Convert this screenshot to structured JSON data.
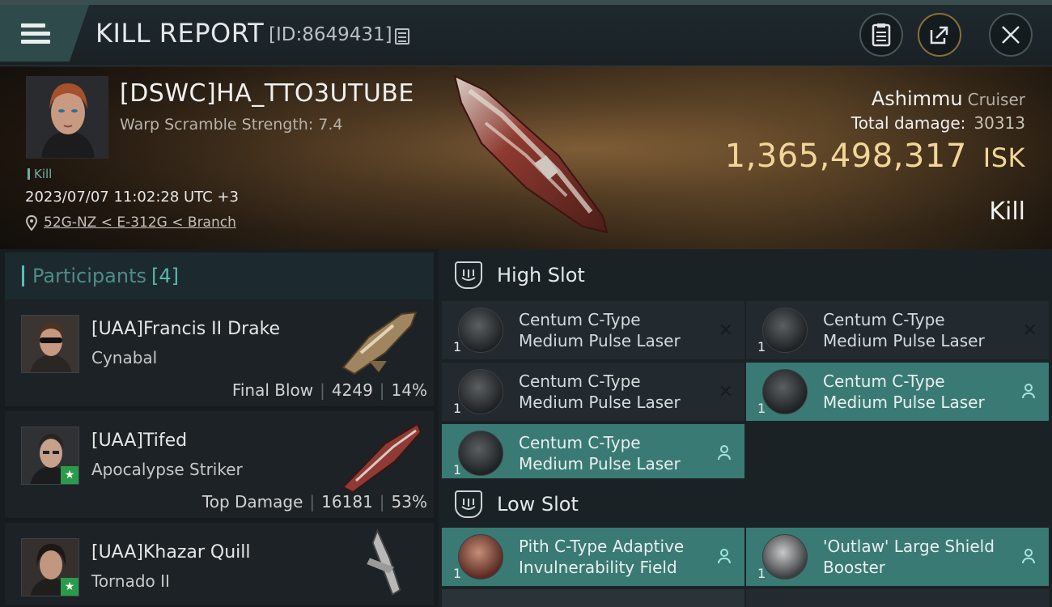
{
  "header": {
    "title": "KILL REPORT",
    "report_id": "[ID:8649431]"
  },
  "victim": {
    "name": "[DSWC]HA_TTO3UTUBE",
    "warp_scramble": "Warp Scramble Strength: 7.4",
    "tag": "Kill",
    "timestamp": "2023/07/07 11:02:28 UTC +3",
    "location": "52G-NZ < E-312G < Branch",
    "ship_name": "Ashimmu",
    "ship_class": "Cruiser",
    "total_damage_label": "Total damage:",
    "total_damage": "30313",
    "isk_value": "1,365,498,317",
    "isk_unit": "ISK",
    "result": "Kill"
  },
  "participants": {
    "label": "Participants",
    "count": "[4]",
    "items": [
      {
        "name": "[UAA]Francis II Drake",
        "ship": "Cynabal",
        "stat_label": "Final Blow",
        "damage": "4249",
        "percent": "14%"
      },
      {
        "name": "[UAA]Tifed",
        "ship": "Apocalypse Striker",
        "stat_label": "Top Damage",
        "damage": "16181",
        "percent": "53%"
      },
      {
        "name": "[UAA]Khazar Quill",
        "ship": "Tornado II"
      }
    ]
  },
  "high_slot": {
    "label": "High Slot",
    "modules": [
      {
        "line1": "Centum C-Type",
        "line2": "Medium Pulse Laser",
        "qty": "1"
      },
      {
        "line1": "Centum C-Type",
        "line2": "Medium Pulse Laser",
        "qty": "1"
      },
      {
        "line1": "Centum C-Type",
        "line2": "Medium Pulse Laser",
        "qty": "1"
      },
      {
        "line1": "Centum C-Type",
        "line2": "Medium Pulse Laser",
        "qty": "1"
      },
      {
        "line1": "Centum C-Type",
        "line2": "Medium Pulse Laser",
        "qty": "1"
      }
    ]
  },
  "low_slot": {
    "label": "Low Slot",
    "modules": [
      {
        "line1": "Pith C-Type Adaptive",
        "line2": "Invulnerability Field",
        "qty": "1"
      },
      {
        "line1": "'Outlaw' Large Shield",
        "line2": "Booster",
        "qty": "1"
      }
    ]
  },
  "colors": {
    "teal_accent": "#3a7a74",
    "isk_gold": "#f2d698",
    "participant_label": "#4f8c86"
  }
}
